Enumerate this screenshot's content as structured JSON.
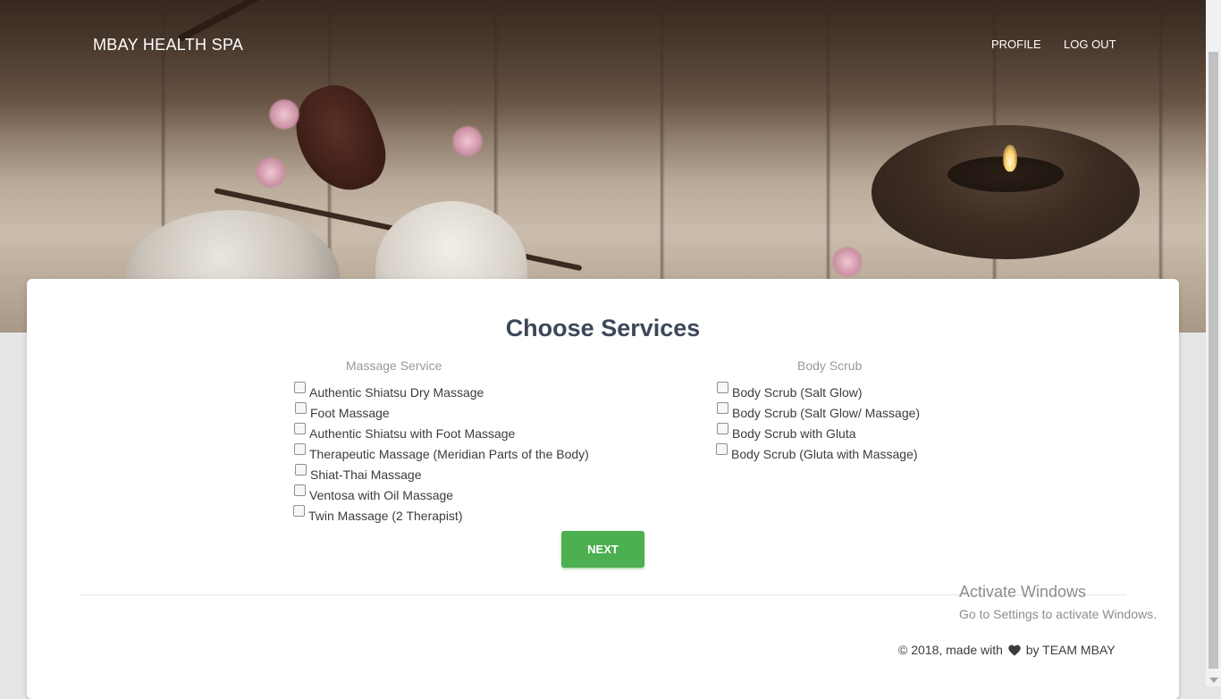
{
  "header": {
    "brand": "MBAY HEALTH SPA",
    "nav": {
      "profile": "PROFILE",
      "logout": "LOG OUT"
    }
  },
  "main": {
    "title": "Choose Services",
    "massage": {
      "heading": "Massage Service",
      "items": [
        "Authentic Shiatsu Dry Massage",
        "Foot Massage",
        "Authentic Shiatsu with Foot Massage",
        "Therapeutic Massage (Meridian Parts of the Body)",
        "Shiat-Thai Massage",
        "Ventosa with Oil Massage",
        "Twin Massage (2 Therapist)"
      ]
    },
    "scrub": {
      "heading": "Body Scrub",
      "items": [
        "Body Scrub (Salt Glow)",
        "Body Scrub (Salt Glow/ Massage)",
        "Body Scrub with Gluta",
        "Body Scrub (Gluta with Massage)"
      ]
    },
    "next_label": "NEXT"
  },
  "footer": {
    "text_before": "© 2018, made with",
    "text_after": "by TEAM MBAY"
  },
  "watermark": {
    "title": "Activate Windows",
    "subtitle": "Go to Settings to activate Windows."
  },
  "colors": {
    "accent_green": "#4caf50",
    "title_color": "#3c4858"
  },
  "icons": [
    "heart-icon"
  ]
}
